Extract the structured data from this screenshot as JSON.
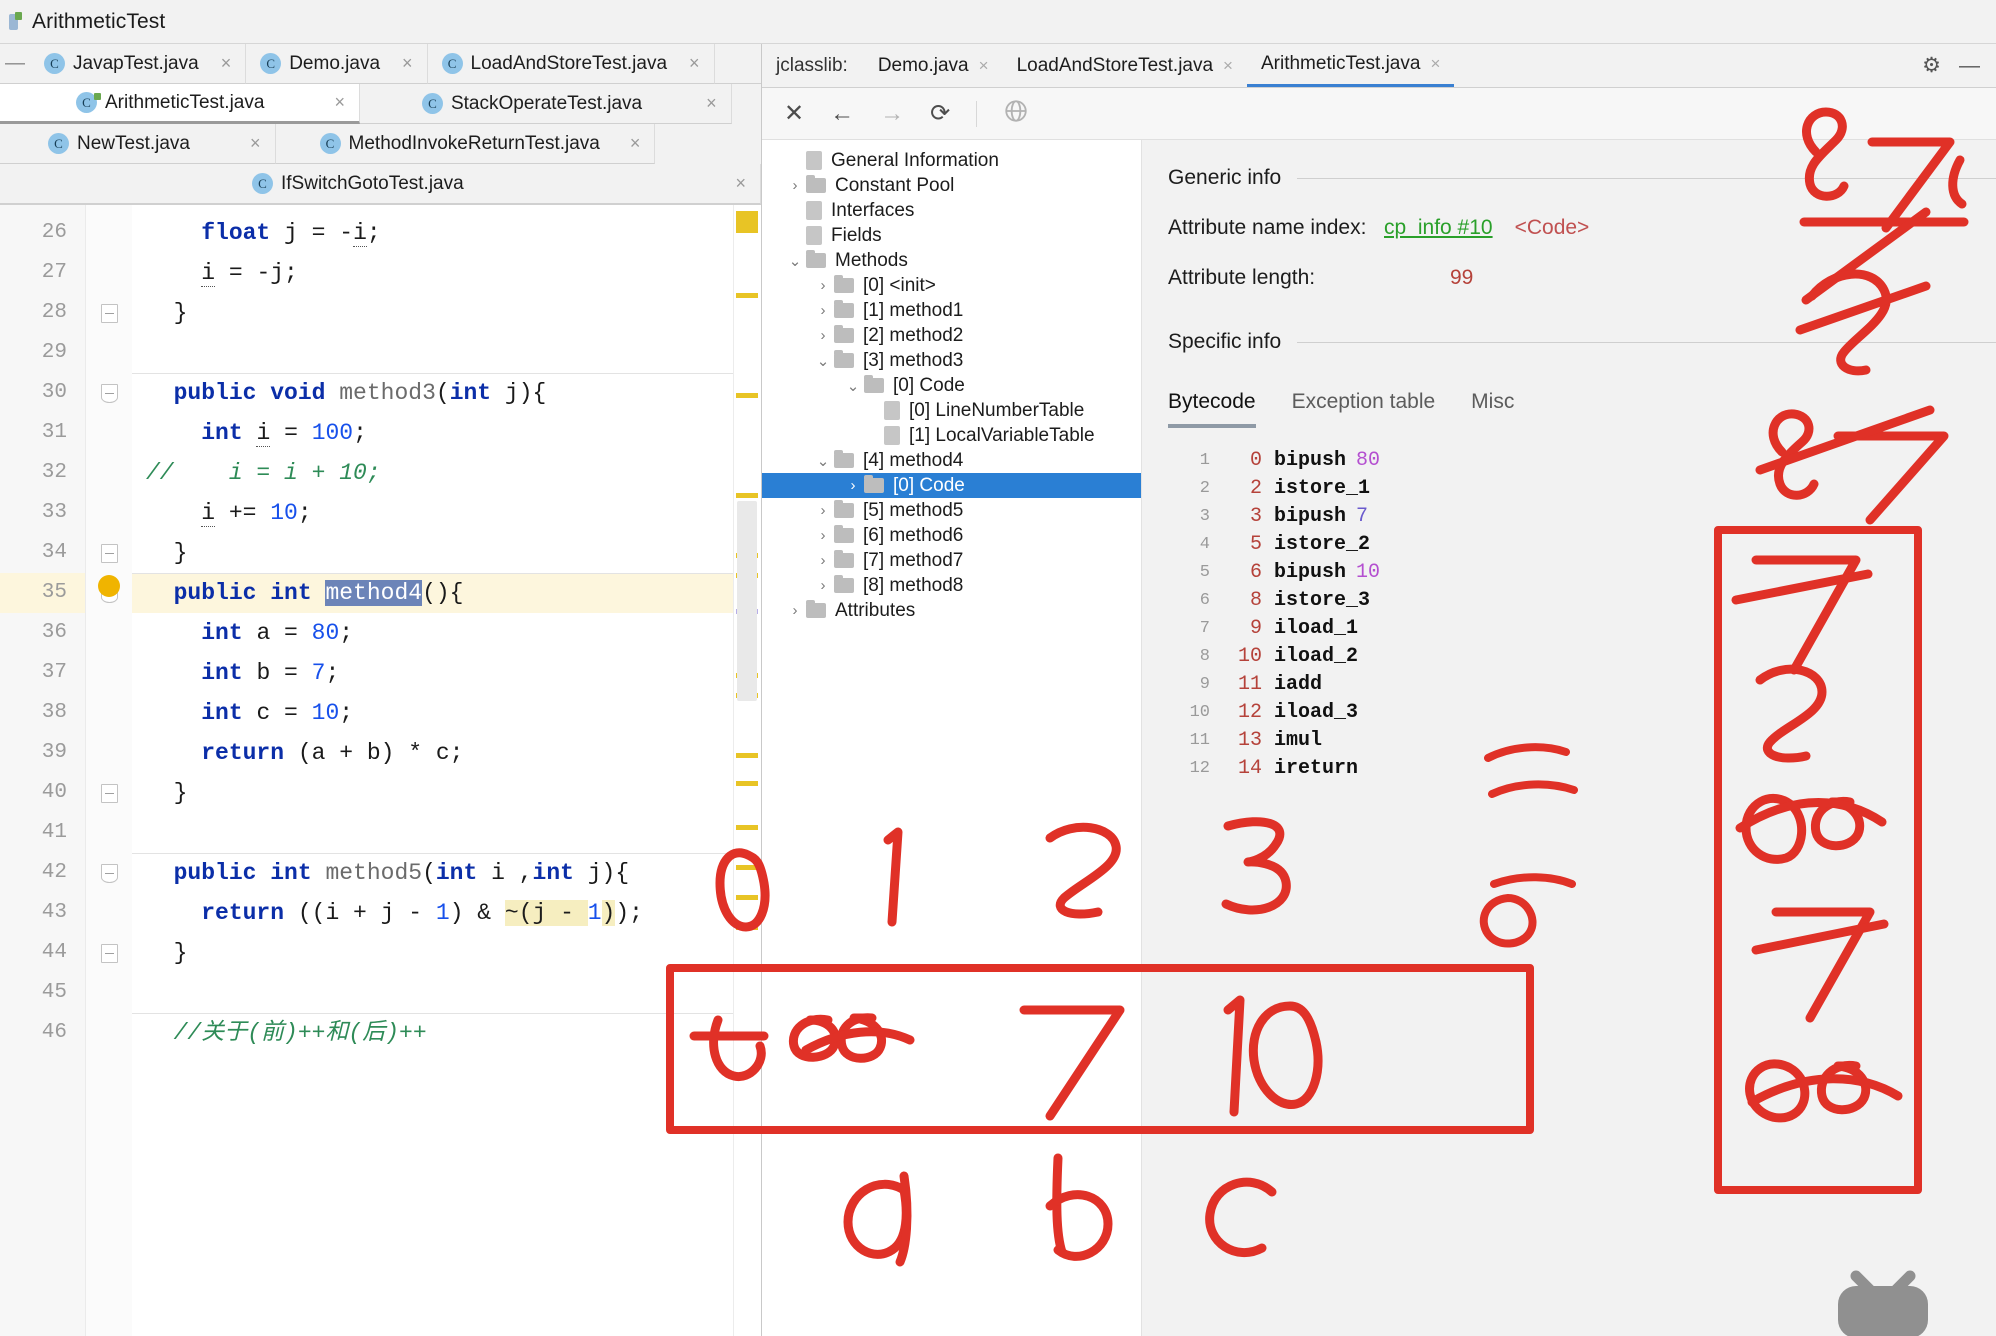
{
  "window": {
    "title": "ArithmeticTest",
    "app_icon": "project-icon"
  },
  "editor": {
    "tab_rows": [
      [
        {
          "label": "JavapTest.java",
          "icon": "java-class-icon",
          "close": "×",
          "active": false
        },
        {
          "label": "Demo.java",
          "icon": "java-class-icon",
          "close": "×",
          "active": false
        },
        {
          "label": "LoadAndStoreTest.java",
          "icon": "java-class-icon",
          "close": "×",
          "active": false
        }
      ],
      [
        {
          "label": "ArithmeticTest.java",
          "icon": "java-class-icon-modified",
          "close": "×",
          "active": true
        },
        {
          "label": "StackOperateTest.java",
          "icon": "java-class-icon",
          "close": "×",
          "active": false
        }
      ],
      [
        {
          "label": "NewTest.java",
          "icon": "java-class-icon",
          "close": "×",
          "active": false
        },
        {
          "label": "MethodInvokeReturnTest.java",
          "icon": "java-class-icon",
          "close": "×",
          "active": false
        }
      ],
      [
        {
          "label": "IfSwitchGotoTest.java",
          "icon": "java-class-icon",
          "close": "×",
          "active": false
        }
      ]
    ],
    "selected_token": "method4",
    "highlighted_line": 35,
    "lines": [
      {
        "n": 26,
        "text": "        float j = -i;"
      },
      {
        "n": 27,
        "text": "        i = -j;"
      },
      {
        "n": 28,
        "text": "    }"
      },
      {
        "n": 29,
        "text": ""
      },
      {
        "n": 30,
        "text": "    public void method3(int j){"
      },
      {
        "n": 31,
        "text": "        int i = 100;"
      },
      {
        "n": 32,
        "text": "//        i = i + 10;"
      },
      {
        "n": 33,
        "text": "        i += 10;"
      },
      {
        "n": 34,
        "text": "    }"
      },
      {
        "n": 35,
        "text": "    public int method4(){"
      },
      {
        "n": 36,
        "text": "        int a = 80;"
      },
      {
        "n": 37,
        "text": "        int b = 7;"
      },
      {
        "n": 38,
        "text": "        int c = 10;"
      },
      {
        "n": 39,
        "text": "        return (a + b) * c;"
      },
      {
        "n": 40,
        "text": "    }"
      },
      {
        "n": 41,
        "text": ""
      },
      {
        "n": 42,
        "text": "    public int method5(int i ,int j){"
      },
      {
        "n": 43,
        "text": "        return ((i + j - 1) & ~(j - 1));"
      },
      {
        "n": 44,
        "text": "    }"
      },
      {
        "n": 45,
        "text": ""
      },
      {
        "n": 46,
        "text": "    //关于(前)++和(后)++"
      }
    ]
  },
  "jclasslib": {
    "panel_label": "jclasslib:",
    "tabs": [
      {
        "label": "Demo.java",
        "close": "×",
        "active": false
      },
      {
        "label": "LoadAndStoreTest.java",
        "close": "×",
        "active": false
      },
      {
        "label": "ArithmeticTest.java",
        "close": "×",
        "active": true
      }
    ],
    "gear": "⚙",
    "minimize": "—",
    "toolbar": [
      {
        "name": "close-icon",
        "glyph": "✕",
        "dim": false
      },
      {
        "name": "back-icon",
        "glyph": "←",
        "dim": false
      },
      {
        "name": "forward-icon",
        "glyph": "→",
        "dim": true
      },
      {
        "name": "reload-icon",
        "glyph": "⟳",
        "dim": false
      },
      {
        "name": "browse-icon",
        "glyph": "🌐",
        "dim": true
      }
    ],
    "tree": [
      {
        "label": "General Information",
        "indent": 1,
        "arrow": "",
        "kind": "file",
        "selected": false
      },
      {
        "label": "Constant Pool",
        "indent": 0,
        "arrow": "›",
        "kind": "folder",
        "selected": false
      },
      {
        "label": "Interfaces",
        "indent": 1,
        "arrow": "",
        "kind": "file",
        "selected": false
      },
      {
        "label": "Fields",
        "indent": 1,
        "arrow": "",
        "kind": "file",
        "selected": false
      },
      {
        "label": "Methods",
        "indent": 0,
        "arrow": "⌄",
        "kind": "folder",
        "selected": false
      },
      {
        "label": "[0] <init>",
        "indent": 1,
        "arrow": "›",
        "kind": "folder",
        "selected": false
      },
      {
        "label": "[1] method1",
        "indent": 1,
        "arrow": "›",
        "kind": "folder",
        "selected": false
      },
      {
        "label": "[2] method2",
        "indent": 1,
        "arrow": "›",
        "kind": "folder",
        "selected": false
      },
      {
        "label": "[3] method3",
        "indent": 1,
        "arrow": "⌄",
        "kind": "folder",
        "selected": false
      },
      {
        "label": "[0] Code",
        "indent": 2,
        "arrow": "⌄",
        "kind": "folder",
        "selected": false
      },
      {
        "label": "[0] LineNumberTable",
        "indent": 3,
        "arrow": "",
        "kind": "file",
        "selected": false
      },
      {
        "label": "[1] LocalVariableTable",
        "indent": 3,
        "arrow": "",
        "kind": "file",
        "selected": false
      },
      {
        "label": "[4] method4",
        "indent": 1,
        "arrow": "⌄",
        "kind": "folder",
        "selected": false
      },
      {
        "label": "[0] Code",
        "indent": 2,
        "arrow": "›",
        "kind": "folder",
        "selected": true
      },
      {
        "label": "[5] method5",
        "indent": 1,
        "arrow": "›",
        "kind": "folder",
        "selected": false
      },
      {
        "label": "[6] method6",
        "indent": 1,
        "arrow": "›",
        "kind": "folder",
        "selected": false
      },
      {
        "label": "[7] method7",
        "indent": 1,
        "arrow": "›",
        "kind": "folder",
        "selected": false
      },
      {
        "label": "[8] method8",
        "indent": 1,
        "arrow": "›",
        "kind": "folder",
        "selected": false
      },
      {
        "label": "Attributes",
        "indent": 0,
        "arrow": "›",
        "kind": "folder",
        "selected": false
      }
    ],
    "detail": {
      "generic_info_heading": "Generic info",
      "attr_name_index_label": "Attribute name index:",
      "attr_name_index_value": "cp_info #10",
      "attr_name_index_note": "<Code>",
      "attr_length_label": "Attribute length:",
      "attr_length_value": "99",
      "specific_info_heading": "Specific info",
      "bytecode_tabs": [
        {
          "label": "Bytecode",
          "active": true
        },
        {
          "label": "Exception table",
          "active": false
        },
        {
          "label": "Misc",
          "active": false
        }
      ],
      "bytecode": [
        {
          "idx": "1",
          "offset": "0",
          "op": "bipush",
          "arg": "80"
        },
        {
          "idx": "2",
          "offset": "2",
          "op": "istore_1",
          "arg": ""
        },
        {
          "idx": "3",
          "offset": "3",
          "op": "bipush",
          "arg": "7"
        },
        {
          "idx": "4",
          "offset": "5",
          "op": "istore_2",
          "arg": ""
        },
        {
          "idx": "5",
          "offset": "6",
          "op": "bipush",
          "arg": "10"
        },
        {
          "idx": "6",
          "offset": "8",
          "op": "istore_3",
          "arg": ""
        },
        {
          "idx": "7",
          "offset": "9",
          "op": "iload_1",
          "arg": ""
        },
        {
          "idx": "8",
          "offset": "10",
          "op": "iload_2",
          "arg": ""
        },
        {
          "idx": "9",
          "offset": "11",
          "op": "iadd",
          "arg": ""
        },
        {
          "idx": "10",
          "offset": "12",
          "op": "iload_3",
          "arg": ""
        },
        {
          "idx": "11",
          "offset": "13",
          "op": "imul",
          "arg": ""
        },
        {
          "idx": "12",
          "offset": "14",
          "op": "ireturn",
          "arg": ""
        }
      ]
    }
  },
  "annotations": {
    "ink_color": "#e03127",
    "slot_digits": [
      "0",
      "1",
      "2",
      "3"
    ],
    "var_labels": [
      "a",
      "b",
      "c"
    ],
    "boxed_values": [
      "80",
      "7",
      "10"
    ],
    "right_column_marks": [
      "7",
      "2",
      "80",
      "7",
      "80"
    ],
    "top_marks": [
      "8",
      "7",
      "2",
      "8",
      "7"
    ]
  }
}
